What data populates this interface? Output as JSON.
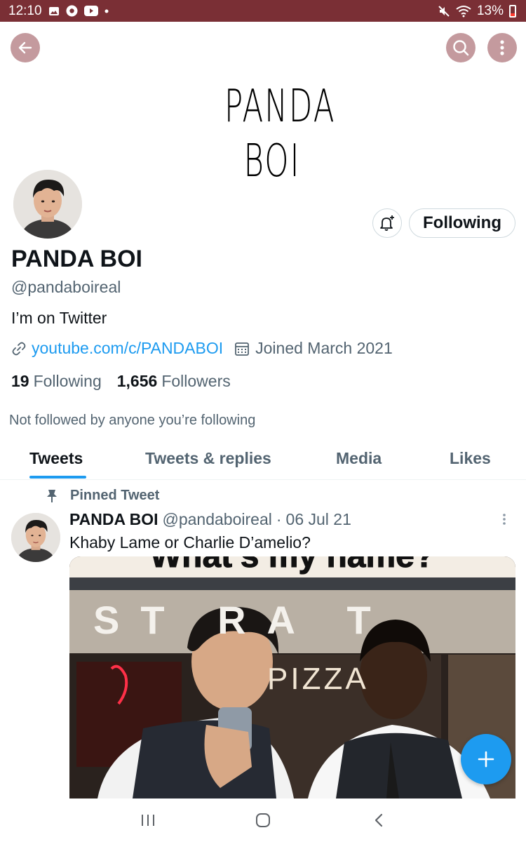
{
  "status_bar": {
    "time": "12:10",
    "battery": "13%",
    "icons": [
      "image-icon",
      "chrome-icon",
      "youtube-icon",
      "dot-icon",
      "mute-icon",
      "wifi-icon",
      "battery-icon"
    ],
    "background": "#7a2f35"
  },
  "banner": {
    "logo_line1": "PANDA",
    "logo_line2": "BOI"
  },
  "header_buttons": [
    "back-icon",
    "search-icon",
    "more-vertical-icon"
  ],
  "profile": {
    "display_name": "PANDA BOI",
    "handle": "@pandaboireal",
    "bio": "I’m on Twitter",
    "website": "youtube.com/c/PANDABOI",
    "joined": "Joined March 2021",
    "following_count": "19",
    "following_label": "Following",
    "followers_count": "1,656",
    "followers_label": "Followers",
    "not_followed_text": "Not followed by anyone you’re following",
    "follow_button": "Following"
  },
  "tabs": [
    {
      "label": "Tweets",
      "active": true
    },
    {
      "label": "Tweets & replies",
      "active": false
    },
    {
      "label": "Media",
      "active": false
    },
    {
      "label": "Likes",
      "active": false
    }
  ],
  "pinned_tweet": {
    "pinned_label": "Pinned Tweet",
    "name": "PANDA BOI",
    "handle": "@pandaboireal",
    "separator": "·",
    "date": "06 Jul 21",
    "text": "Khaby Lame or Charlie D’amelio?",
    "media_caption": "What’s my name?",
    "media_storefront_text": "ST  RA  T",
    "media_sign_text": "PIZZA"
  },
  "colors": {
    "accent": "#1d9bf0",
    "header_button": "#c49a9e",
    "secondary_text": "#536471"
  }
}
